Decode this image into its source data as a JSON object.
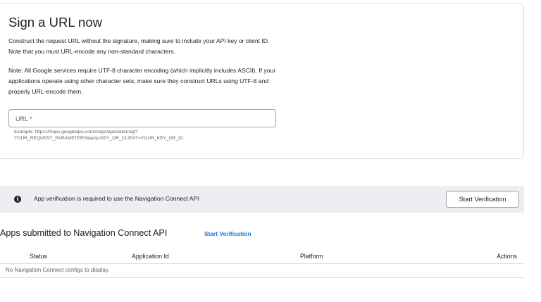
{
  "sign_url": {
    "title": "Sign a URL now",
    "paragraph1": "Construct the request URL without the signature, making sure to include your API key or client ID. Note that you must URL-encode any non-standard characters.",
    "paragraph2": "Note: All Google services require UTF-8 character encoding (which implicitly includes ASCII). If your applications operate using other character sets, make sure they construct URLs using UTF-8 and properly URL-encode them.",
    "url_input": {
      "placeholder": "URL *",
      "value": ""
    },
    "example_line1": "Example: https://maps.googleapis.com/maps/api/staticmap?",
    "example_line2": "YOUR_REQUEST_PARAMETERS&amp;KEY_OR_CLIENT=YOUR_KEY_OR_ID"
  },
  "verification_banner": {
    "icon": "info-icon",
    "message": "App verification is required to use the Navigation Connect API",
    "button_label": "Start Verification"
  },
  "apps_section": {
    "title": "Apps submitted to Navigation Connect API",
    "link_label": "Start Verification",
    "columns": [
      "Status",
      "Application Id",
      "Platform",
      "Actions"
    ],
    "empty_message": "No Navigation Connect configs to display."
  },
  "colors": {
    "accent": "#1a73e8",
    "banner_bg": "#eceef1",
    "border": "#dadce0"
  }
}
